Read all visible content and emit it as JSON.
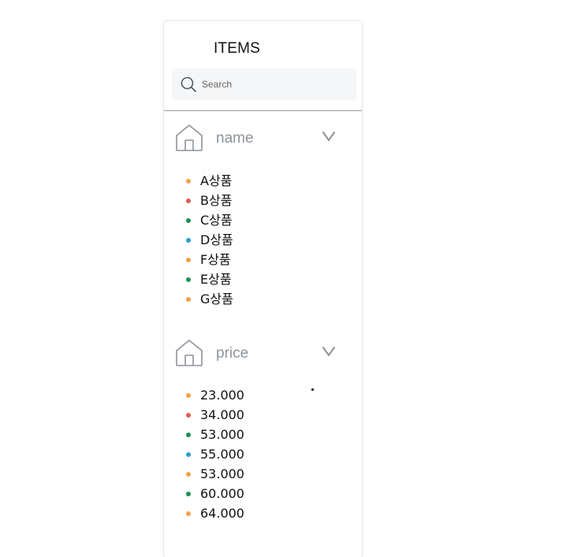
{
  "panel": {
    "title": "ITEMS"
  },
  "search": {
    "placeholder": "Search",
    "icon": "search-icon"
  },
  "colors": {
    "orange": "#f0a04b",
    "red": "#e05a50",
    "green": "#1f8f55",
    "blue": "#2a9fd0",
    "label_gray": "#8e939b"
  },
  "sections": [
    {
      "label": "name",
      "icon": "home-icon",
      "toggle_icon": "chevron-down-icon",
      "items": [
        {
          "text": "A상품",
          "color": "#f0a04b"
        },
        {
          "text": "B상품",
          "color": "#e05a50"
        },
        {
          "text": "C상품",
          "color": "#1f8f55"
        },
        {
          "text": "D상품",
          "color": "#2a9fd0"
        },
        {
          "text": "F상품",
          "color": "#f0a04b"
        },
        {
          "text": "E상품",
          "color": "#1f8f55"
        },
        {
          "text": "G상품",
          "color": "#f0a04b"
        }
      ]
    },
    {
      "label": "price",
      "icon": "home-icon",
      "toggle_icon": "chevron-down-icon",
      "items": [
        {
          "text": "23.000",
          "color": "#f0a04b"
        },
        {
          "text": "34.000",
          "color": "#e05a50"
        },
        {
          "text": "53.000",
          "color": "#1f8f55"
        },
        {
          "text": "55.000",
          "color": "#2a9fd0"
        },
        {
          "text": "53.000",
          "color": "#f0a04b"
        },
        {
          "text": "60.000",
          "color": "#1f8f55"
        },
        {
          "text": "64.000",
          "color": "#f0a04b"
        }
      ]
    }
  ]
}
